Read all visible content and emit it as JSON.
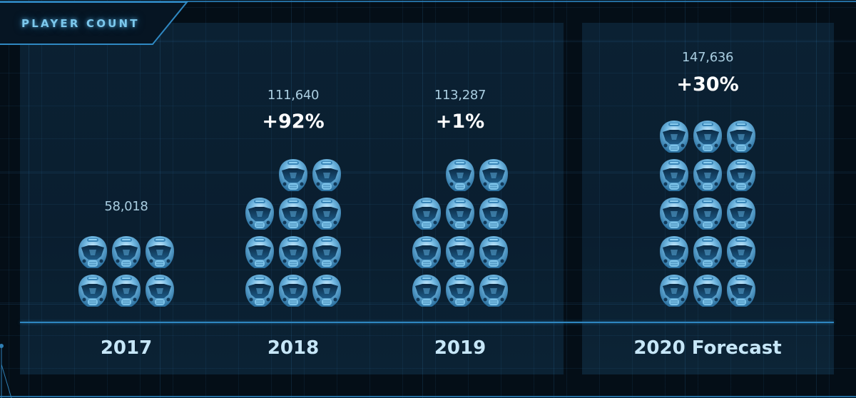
{
  "title": "PLAYER COUNT",
  "chart_data": {
    "type": "bar",
    "title": "PLAYER COUNT",
    "subtype": "pictogram",
    "icon": "helmet-icon",
    "categories": [
      "2017",
      "2018",
      "2019",
      "2020 Forecast"
    ],
    "values": [
      58018,
      111640,
      113287,
      147636
    ],
    "value_labels": [
      "58,018",
      "111,640",
      "113,287",
      "147,636"
    ],
    "change_labels": [
      null,
      "+92%",
      "+1%",
      "+30%"
    ],
    "icon_counts": [
      6,
      11,
      11,
      15
    ],
    "icons_per_row": 3,
    "xlabel": "",
    "ylabel": "",
    "grid": true,
    "forecast_category": "2020 Forecast"
  },
  "colors": {
    "accent": "#2a7fb8",
    "title": "#7cc8ec",
    "value_text": "#a9cde0",
    "change_text": "#ffffff",
    "year_text": "#c6e6f7",
    "background": "#040e17",
    "panel": "#0a1e2f"
  }
}
